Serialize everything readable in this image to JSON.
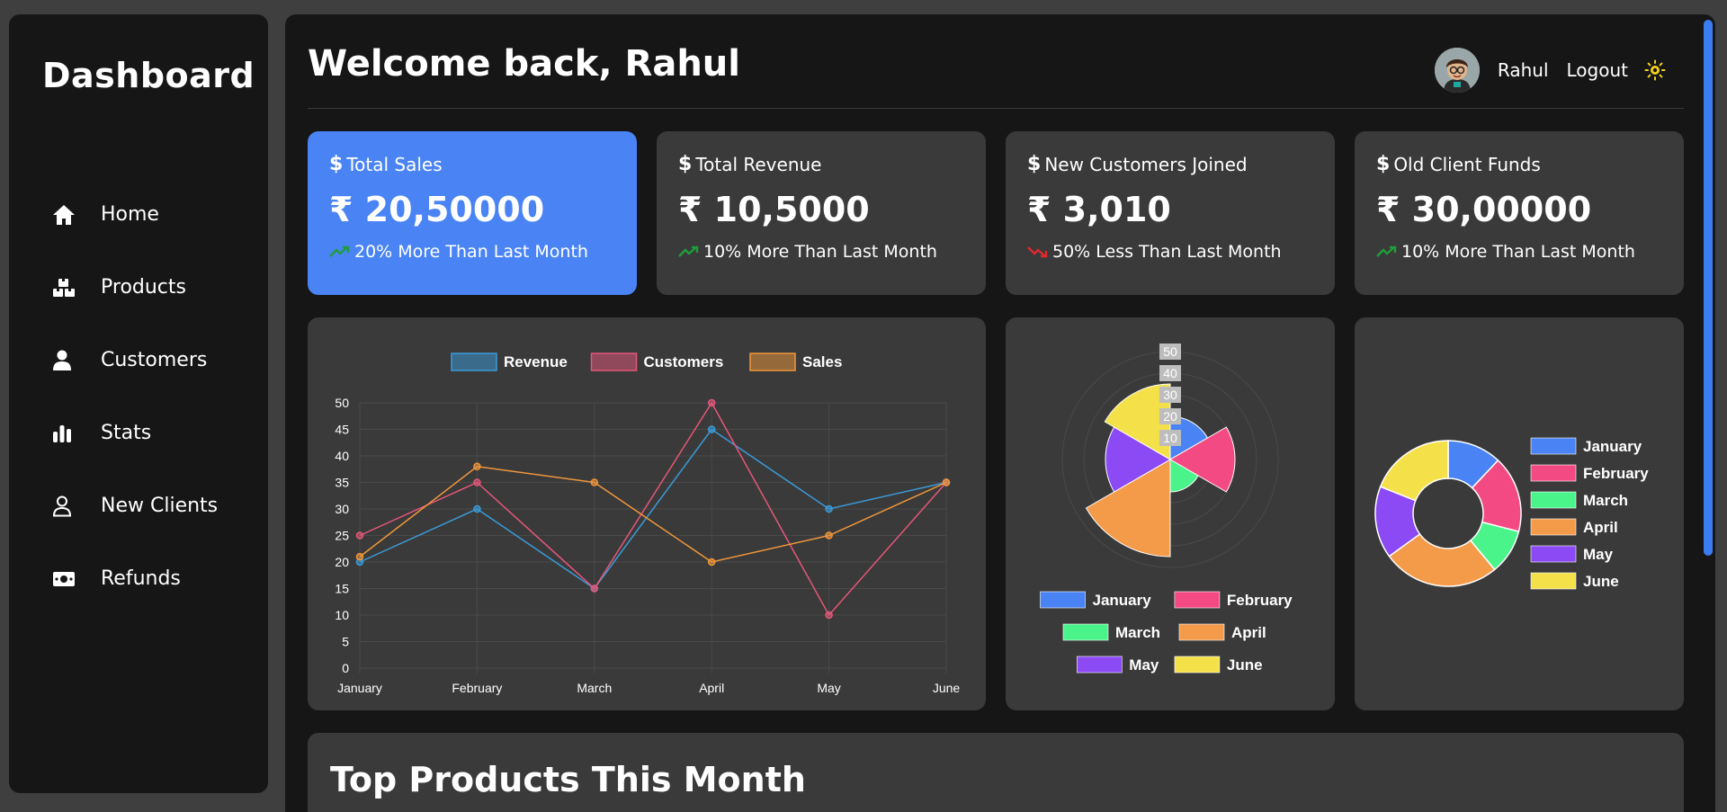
{
  "sidebar": {
    "brand": "Dashboard",
    "items": [
      {
        "label": "Home",
        "icon": "home-icon"
      },
      {
        "label": "Products",
        "icon": "boxes-icon"
      },
      {
        "label": "Customers",
        "icon": "user-icon"
      },
      {
        "label": "Stats",
        "icon": "bar-chart-icon"
      },
      {
        "label": "New Clients",
        "icon": "user-outline-icon"
      },
      {
        "label": "Refunds",
        "icon": "money-icon"
      }
    ]
  },
  "header": {
    "welcome": "Welcome back, Rahul",
    "user_name": "Rahul",
    "logout_label": "Logout",
    "theme_icon": "sun-icon"
  },
  "cards": [
    {
      "title": "Total Sales",
      "value": "₹ 20,50000",
      "trend": "20% More Than Last Month",
      "direction": "up"
    },
    {
      "title": "Total Revenue",
      "value": "₹ 10,5000",
      "trend": "10% More Than Last Month",
      "direction": "up"
    },
    {
      "title": "New Customers Joined",
      "value": "₹ 3,010",
      "trend": "50% Less Than Last Month",
      "direction": "down"
    },
    {
      "title": "Old Client Funds",
      "value": "₹ 30,00000",
      "trend": "10% More Than Last Month",
      "direction": "up"
    }
  ],
  "colors": {
    "accent": "#4a84f4",
    "trend_up": "#1f9d3a",
    "trend_down": "#e0282d",
    "revenue": "#3a9bd9",
    "customers": "#e4577a",
    "sales": "#f0973a"
  },
  "chart_data": [
    {
      "type": "line",
      "categories": [
        "January",
        "February",
        "March",
        "April",
        "May",
        "June"
      ],
      "series": [
        {
          "name": "Revenue",
          "color": "#3a9bd9",
          "values": [
            20,
            30,
            15,
            45,
            30,
            35
          ]
        },
        {
          "name": "Customers",
          "color": "#e4577a",
          "values": [
            25,
            35,
            15,
            50,
            10,
            35
          ]
        },
        {
          "name": "Sales",
          "color": "#f0973a",
          "values": [
            21,
            38,
            35,
            20,
            25,
            35
          ]
        }
      ],
      "ylim": [
        0,
        50
      ],
      "yticks": [
        0,
        5,
        10,
        15,
        20,
        25,
        30,
        35,
        40,
        45,
        50
      ],
      "grid": true,
      "legend": "top-center"
    },
    {
      "type": "polarArea",
      "labels": [
        "January",
        "February",
        "March",
        "April",
        "May",
        "June"
      ],
      "values": [
        20,
        30,
        15,
        45,
        30,
        35
      ],
      "colors": [
        "#4a84f4",
        "#f44a83",
        "#4af48b",
        "#f49b4a",
        "#8b4af4",
        "#f4e14a"
      ],
      "rlim": [
        0,
        50
      ],
      "rticks": [
        "10",
        "20",
        "30",
        "40",
        "50"
      ],
      "legend": "bottom"
    },
    {
      "type": "doughnut",
      "labels": [
        "January",
        "February",
        "March",
        "April",
        "May",
        "June"
      ],
      "values": [
        12,
        17,
        10,
        26,
        16,
        19
      ],
      "colors": [
        "#4a84f4",
        "#f44a83",
        "#4af48b",
        "#f49b4a",
        "#8b4af4",
        "#f4e14a"
      ],
      "legend": "right"
    }
  ],
  "bottom": {
    "title": "Top Products This Month"
  }
}
